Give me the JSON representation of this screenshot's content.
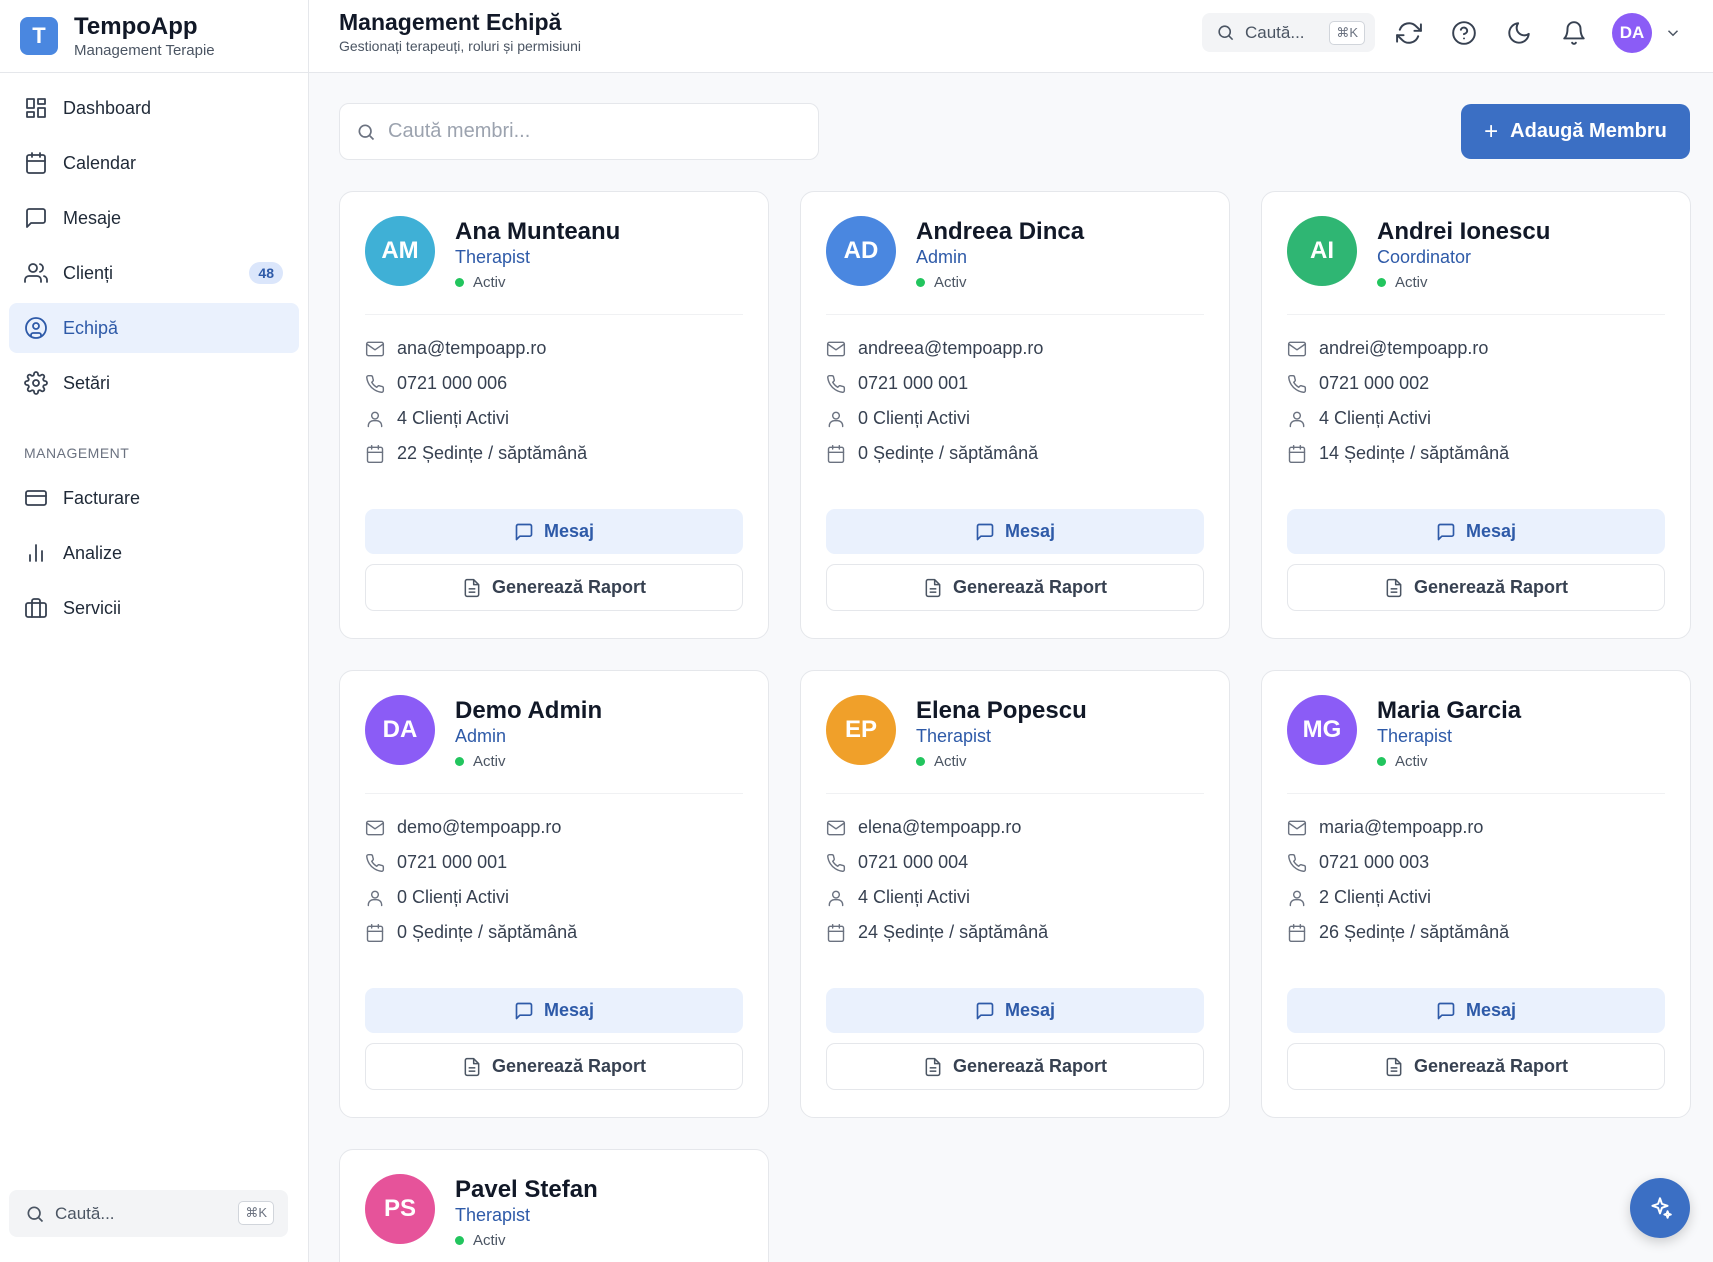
{
  "brand": {
    "logo_letter": "T",
    "name": "TempoApp",
    "subtitle": "Management Terapie"
  },
  "sidebar": {
    "items": [
      {
        "label": "Dashboard",
        "icon": "dashboard-icon"
      },
      {
        "label": "Calendar",
        "icon": "calendar-icon"
      },
      {
        "label": "Mesaje",
        "icon": "message-icon"
      },
      {
        "label": "Clienți",
        "icon": "users-icon",
        "badge": "48"
      },
      {
        "label": "Echipă",
        "icon": "user-circle-icon",
        "active": true
      },
      {
        "label": "Setări",
        "icon": "gear-icon"
      }
    ],
    "section_label": "MANAGEMENT",
    "management_items": [
      {
        "label": "Facturare",
        "icon": "credit-card-icon"
      },
      {
        "label": "Analize",
        "icon": "bar-chart-icon"
      },
      {
        "label": "Servicii",
        "icon": "briefcase-icon"
      }
    ],
    "search": {
      "placeholder": "Caută...",
      "shortcut": "⌘K"
    }
  },
  "header": {
    "title": "Management Echipă",
    "subtitle": "Gestionați terapeuți, roluri și permisiuni",
    "search": {
      "placeholder": "Caută...",
      "shortcut": "⌘K"
    },
    "user_initials": "DA"
  },
  "main": {
    "search_placeholder": "Caută membri...",
    "add_button": "Adaugă Membru",
    "message_button": "Mesaj",
    "report_button": "Generează Raport",
    "members": [
      {
        "initials": "AM",
        "name": "Ana Munteanu",
        "role": "Therapist",
        "status": "Activ",
        "email": "ana@tempoapp.ro",
        "phone": "0721 000 006",
        "clients": "4 Clienți Activi",
        "sessions": "22 Ședințe / săptămână",
        "color": "#3fb0d6"
      },
      {
        "initials": "AD",
        "name": "Andreea Dinca",
        "role": "Admin",
        "status": "Activ",
        "email": "andreea@tempoapp.ro",
        "phone": "0721 000 001",
        "clients": "0 Clienți Activi",
        "sessions": "0 Ședințe / săptămână",
        "color": "#4a87e0"
      },
      {
        "initials": "AI",
        "name": "Andrei Ionescu",
        "role": "Coordinator",
        "status": "Activ",
        "email": "andrei@tempoapp.ro",
        "phone": "0721 000 002",
        "clients": "4 Clienți Activi",
        "sessions": "14 Ședințe / săptămână",
        "color": "#2fb673"
      },
      {
        "initials": "DA",
        "name": "Demo Admin",
        "role": "Admin",
        "status": "Activ",
        "email": "demo@tempoapp.ro",
        "phone": "0721 000 001",
        "clients": "0 Clienți Activi",
        "sessions": "0 Ședințe / săptămână",
        "color": "#8b5cf6"
      },
      {
        "initials": "EP",
        "name": "Elena Popescu",
        "role": "Therapist",
        "status": "Activ",
        "email": "elena@tempoapp.ro",
        "phone": "0721 000 004",
        "clients": "4 Clienți Activi",
        "sessions": "24 Ședințe / săptămână",
        "color": "#f0a02a"
      },
      {
        "initials": "MG",
        "name": "Maria Garcia",
        "role": "Therapist",
        "status": "Activ",
        "email": "maria@tempoapp.ro",
        "phone": "0721 000 003",
        "clients": "2 Clienți Activi",
        "sessions": "26 Ședințe / săptămână",
        "color": "#8b5cf6"
      },
      {
        "initials": "PS",
        "name": "Pavel Stefan",
        "role": "Therapist",
        "status": "Activ",
        "color": "#e6539a"
      }
    ]
  }
}
